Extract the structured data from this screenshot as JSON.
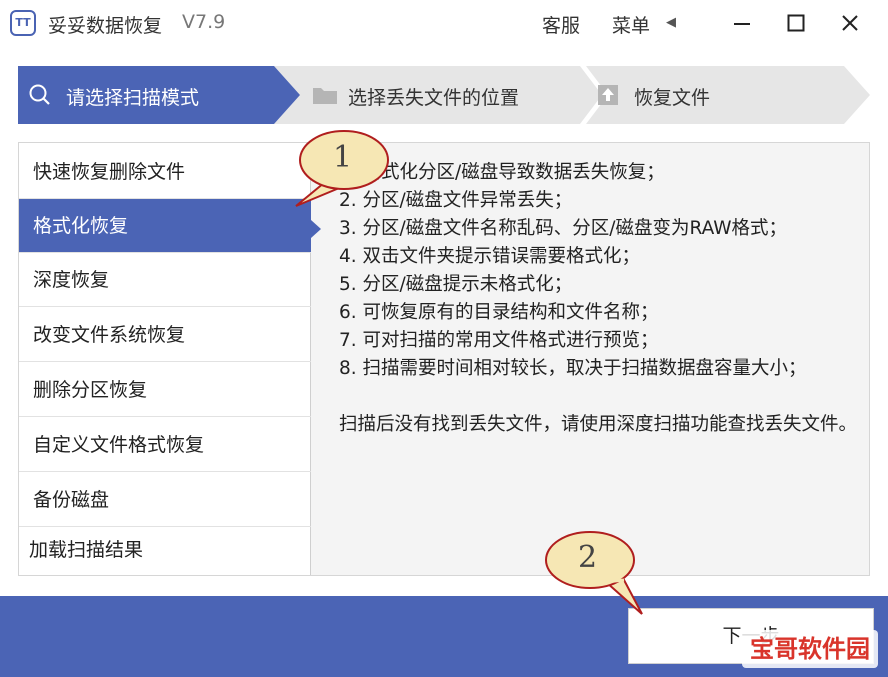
{
  "app": {
    "title": "妥妥数据恢复",
    "version": "V7.9",
    "logo_text": "TT"
  },
  "titlebar": {
    "service_label": "客服",
    "menu_label": "菜单",
    "menu_arrow": "◀"
  },
  "steps": [
    {
      "label": "请选择扫描模式",
      "icon": "search-icon",
      "active": true
    },
    {
      "label": "选择丢失文件的位置",
      "icon": "folder-icon",
      "active": false
    },
    {
      "label": "恢复文件",
      "icon": "upload-icon",
      "active": false
    }
  ],
  "sidebar": {
    "items": [
      {
        "label": "快速恢复删除文件"
      },
      {
        "label": "格式化恢复"
      },
      {
        "label": "深度恢复"
      },
      {
        "label": "改变文件系统恢复"
      },
      {
        "label": "删除分区恢复"
      },
      {
        "label": "自定义文件格式恢复"
      },
      {
        "label": "备份磁盘"
      },
      {
        "label": "加载扫描结果"
      }
    ],
    "selected_index": 1
  },
  "description": {
    "lines": [
      "1. 格式化分区/磁盘导致数据丢失恢复；",
      "2. 分区/磁盘文件异常丢失；",
      "3. 分区/磁盘文件名称乱码、分区/磁盘变为RAW格式；",
      "4. 双击文件夹提示错误需要格式化；",
      "5. 分区/磁盘提示未格式化；",
      "6. 可恢复原有的目录结构和文件名称；",
      "7. 可对扫描的常用文件格式进行预览；",
      "8. 扫描需要时间相对较长，取决于扫描数据盘容量大小；"
    ],
    "note": "扫描后没有找到丢失文件，请使用深度扫描功能查找丢失文件。"
  },
  "footer": {
    "next_label": "下一步"
  },
  "annotations": [
    {
      "number": "1"
    },
    {
      "number": "2"
    }
  ],
  "watermark": {
    "text": "宝哥软件园"
  },
  "colors": {
    "accent": "#4b64b5",
    "step_inactive": "#e6e6e6",
    "panel_bg": "#f4f4f4",
    "bubble_fill": "#f6e7b4",
    "bubble_stroke": "#b01e1e",
    "watermark": "#d9342b"
  }
}
